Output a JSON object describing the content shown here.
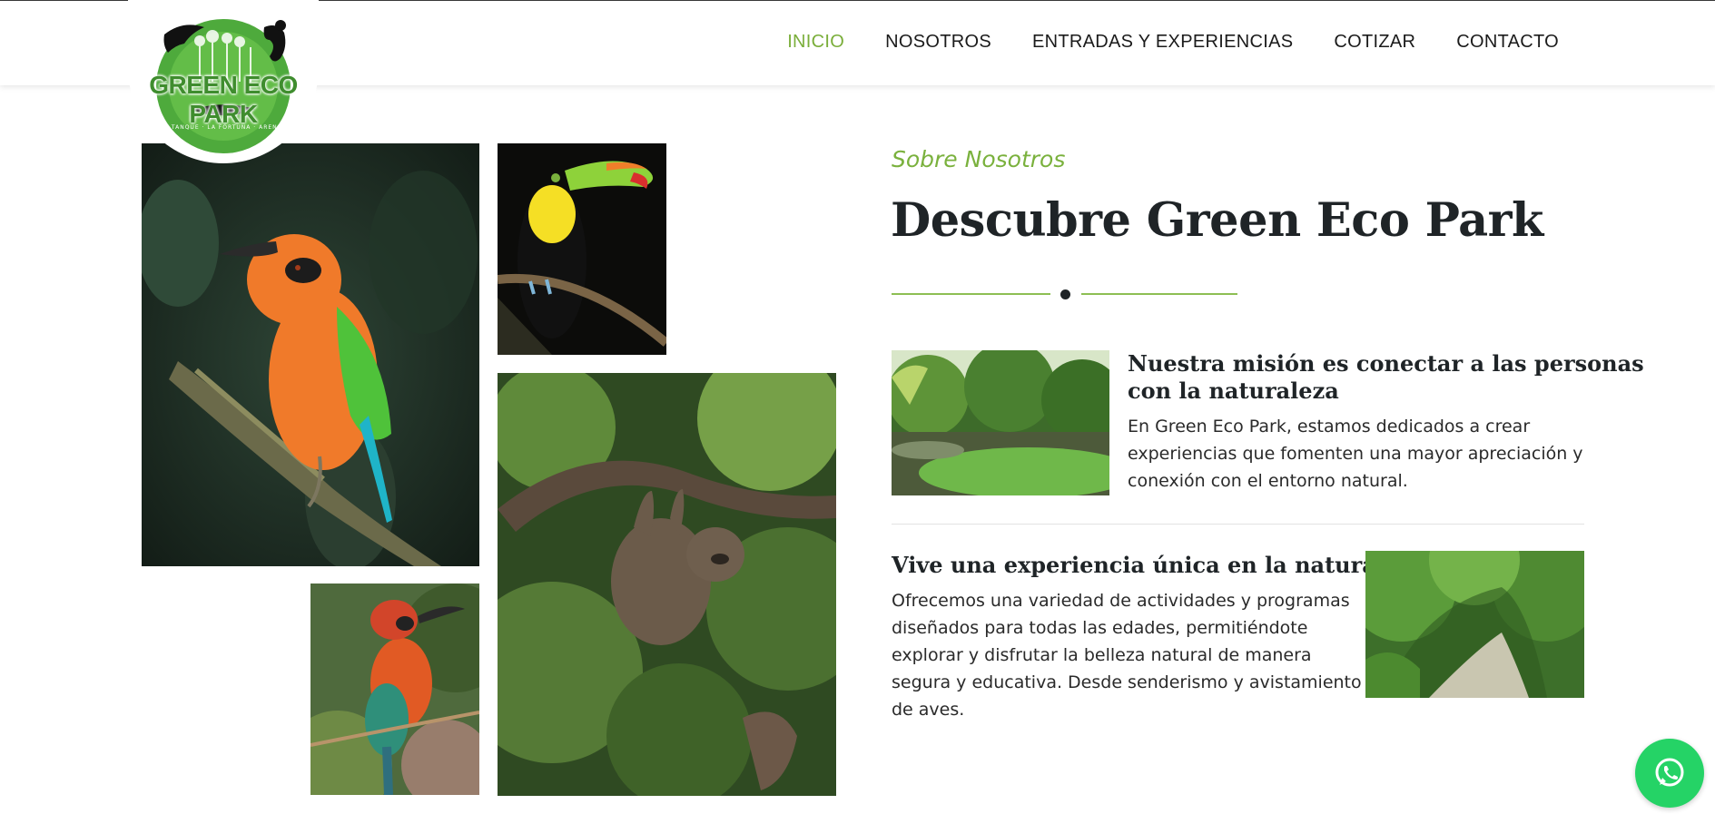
{
  "brand": {
    "logo_name": "GREEN ECO PARK",
    "logo_tagline": "EL TANQUE · LA FORTUNA · ARENAL",
    "accent_color": "#7aae3a",
    "dark_color": "#1f2427"
  },
  "nav": {
    "items": [
      {
        "label": "INICIO",
        "active": true
      },
      {
        "label": "NOSOTROS",
        "active": false
      },
      {
        "label": "ENTRADAS Y EXPERIENCIAS",
        "active": false
      },
      {
        "label": "COTIZAR",
        "active": false
      },
      {
        "label": "CONTACTO",
        "active": false
      }
    ]
  },
  "about": {
    "subtitle": "Sobre Nosotros",
    "title": "Descubre Green Eco Park",
    "features": [
      {
        "heading_line1": "Nuestra misión es conectar a las personas",
        "heading_line2": "con la naturaleza",
        "text_line1": "En Green Eco Park, estamos dedicados a crear",
        "text_line2": "experiencias que fomenten una mayor apreciación y",
        "text_line3": "conexión con el entorno natural."
      },
      {
        "heading_line1": "Vive una experiencia única en la naturaleza",
        "text_line1": "Ofrecemos una variedad de actividades y programas",
        "text_line2": "diseñados para todas las edades, permitiéndote",
        "text_line3": "explorar y disfrutar la belleza natural de manera",
        "text_line4": "segura y educativa. Desde senderismo y avistamiento",
        "text_line5": "de aves."
      }
    ]
  },
  "gallery": {
    "photos": [
      "motmot-bird-photo",
      "toucan-photo",
      "sloth-photo",
      "broad-billed-motmot-photo"
    ]
  },
  "icons": {
    "whatsapp": "whatsapp-icon"
  }
}
